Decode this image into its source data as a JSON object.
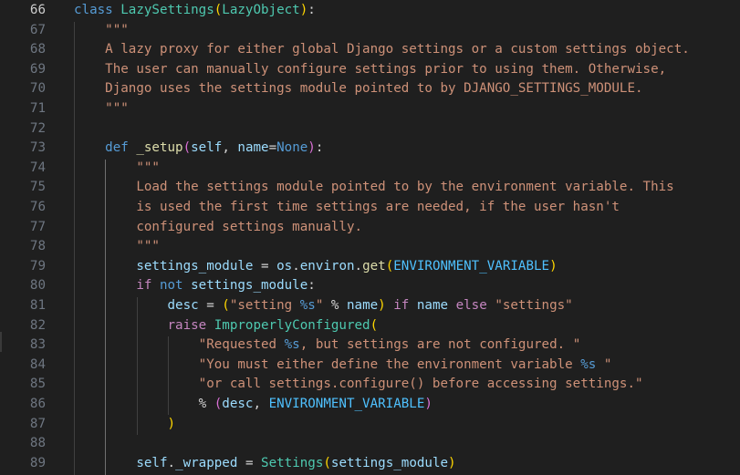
{
  "editor": {
    "active_line": "66",
    "lines": [
      {
        "num": "66",
        "tokens": [
          {
            "t": "kw",
            "v": "class "
          },
          {
            "t": "cls",
            "v": "LazySettings"
          },
          {
            "t": "p1",
            "v": "("
          },
          {
            "t": "cls",
            "v": "LazyObject"
          },
          {
            "t": "p1",
            "v": ")"
          },
          {
            "t": "plain",
            "v": ":"
          }
        ]
      },
      {
        "num": "67",
        "tokens": [
          {
            "t": "str",
            "v": "    \"\"\""
          }
        ]
      },
      {
        "num": "68",
        "tokens": [
          {
            "t": "str",
            "v": "    A lazy proxy for either global Django settings or a custom settings object."
          }
        ]
      },
      {
        "num": "69",
        "tokens": [
          {
            "t": "str",
            "v": "    The user can manually configure settings prior to using them. Otherwise,"
          }
        ]
      },
      {
        "num": "70",
        "tokens": [
          {
            "t": "str",
            "v": "    Django uses the settings module pointed to by DJANGO_SETTINGS_MODULE."
          }
        ]
      },
      {
        "num": "71",
        "tokens": [
          {
            "t": "str",
            "v": "    \"\"\""
          }
        ]
      },
      {
        "num": "72",
        "tokens": []
      },
      {
        "num": "73",
        "tokens": [
          {
            "t": "plain",
            "v": "    "
          },
          {
            "t": "kw",
            "v": "def "
          },
          {
            "t": "fn",
            "v": "_setup"
          },
          {
            "t": "p2",
            "v": "("
          },
          {
            "t": "var",
            "v": "self"
          },
          {
            "t": "plain",
            "v": ", "
          },
          {
            "t": "var",
            "v": "name"
          },
          {
            "t": "plain",
            "v": "="
          },
          {
            "t": "kw",
            "v": "None"
          },
          {
            "t": "p2",
            "v": ")"
          },
          {
            "t": "plain",
            "v": ":"
          }
        ]
      },
      {
        "num": "74",
        "tokens": [
          {
            "t": "str",
            "v": "        \"\"\""
          }
        ]
      },
      {
        "num": "75",
        "tokens": [
          {
            "t": "str",
            "v": "        Load the settings module pointed to by the environment variable. This"
          }
        ]
      },
      {
        "num": "76",
        "tokens": [
          {
            "t": "str",
            "v": "        is used the first time settings are needed, if the user hasn't"
          }
        ]
      },
      {
        "num": "77",
        "tokens": [
          {
            "t": "str",
            "v": "        configured settings manually."
          }
        ]
      },
      {
        "num": "78",
        "tokens": [
          {
            "t": "str",
            "v": "        \"\"\""
          }
        ]
      },
      {
        "num": "79",
        "tokens": [
          {
            "t": "plain",
            "v": "        "
          },
          {
            "t": "var",
            "v": "settings_module"
          },
          {
            "t": "plain",
            "v": " = "
          },
          {
            "t": "var",
            "v": "os"
          },
          {
            "t": "plain",
            "v": "."
          },
          {
            "t": "var",
            "v": "environ"
          },
          {
            "t": "plain",
            "v": "."
          },
          {
            "t": "fn",
            "v": "get"
          },
          {
            "t": "p1",
            "v": "("
          },
          {
            "t": "const",
            "v": "ENVIRONMENT_VARIABLE"
          },
          {
            "t": "p1",
            "v": ")"
          }
        ]
      },
      {
        "num": "80",
        "tokens": [
          {
            "t": "plain",
            "v": "        "
          },
          {
            "t": "ctl",
            "v": "if "
          },
          {
            "t": "kw",
            "v": "not "
          },
          {
            "t": "var",
            "v": "settings_module"
          },
          {
            "t": "plain",
            "v": ":"
          }
        ]
      },
      {
        "num": "81",
        "tokens": [
          {
            "t": "plain",
            "v": "            "
          },
          {
            "t": "var",
            "v": "desc"
          },
          {
            "t": "plain",
            "v": " = "
          },
          {
            "t": "p1",
            "v": "("
          },
          {
            "t": "str",
            "v": "\"setting "
          },
          {
            "t": "fmt",
            "v": "%s"
          },
          {
            "t": "str",
            "v": "\""
          },
          {
            "t": "plain",
            "v": " % "
          },
          {
            "t": "var",
            "v": "name"
          },
          {
            "t": "p1",
            "v": ")"
          },
          {
            "t": "plain",
            "v": " "
          },
          {
            "t": "ctl",
            "v": "if "
          },
          {
            "t": "var",
            "v": "name"
          },
          {
            "t": "plain",
            "v": " "
          },
          {
            "t": "ctl",
            "v": "else "
          },
          {
            "t": "str",
            "v": "\"settings\""
          }
        ]
      },
      {
        "num": "82",
        "tokens": [
          {
            "t": "plain",
            "v": "            "
          },
          {
            "t": "ctl",
            "v": "raise "
          },
          {
            "t": "cls",
            "v": "ImproperlyConfigured"
          },
          {
            "t": "p1",
            "v": "("
          }
        ]
      },
      {
        "num": "83",
        "tokens": [
          {
            "t": "plain",
            "v": "                "
          },
          {
            "t": "str",
            "v": "\"Requested "
          },
          {
            "t": "fmt",
            "v": "%s"
          },
          {
            "t": "str",
            "v": ", but settings are not configured. \""
          }
        ]
      },
      {
        "num": "84",
        "tokens": [
          {
            "t": "plain",
            "v": "                "
          },
          {
            "t": "str",
            "v": "\"You must either define the environment variable "
          },
          {
            "t": "fmt",
            "v": "%s"
          },
          {
            "t": "str",
            "v": " \""
          }
        ]
      },
      {
        "num": "85",
        "tokens": [
          {
            "t": "plain",
            "v": "                "
          },
          {
            "t": "str",
            "v": "\"or call settings.configure() before accessing settings.\""
          }
        ]
      },
      {
        "num": "86",
        "tokens": [
          {
            "t": "plain",
            "v": "                % "
          },
          {
            "t": "p2",
            "v": "("
          },
          {
            "t": "var",
            "v": "desc"
          },
          {
            "t": "plain",
            "v": ", "
          },
          {
            "t": "const",
            "v": "ENVIRONMENT_VARIABLE"
          },
          {
            "t": "p2",
            "v": ")"
          }
        ]
      },
      {
        "num": "87",
        "tokens": [
          {
            "t": "plain",
            "v": "            "
          },
          {
            "t": "p1",
            "v": ")"
          }
        ]
      },
      {
        "num": "88",
        "tokens": []
      },
      {
        "num": "89",
        "tokens": [
          {
            "t": "plain",
            "v": "        "
          },
          {
            "t": "var",
            "v": "self"
          },
          {
            "t": "plain",
            "v": "."
          },
          {
            "t": "var",
            "v": "_wrapped"
          },
          {
            "t": "plain",
            "v": " = "
          },
          {
            "t": "cls",
            "v": "Settings"
          },
          {
            "t": "p1",
            "v": "("
          },
          {
            "t": "var",
            "v": "settings_module"
          },
          {
            "t": "p1",
            "v": ")"
          }
        ]
      }
    ]
  },
  "colors": {
    "background": "#1f1f1f",
    "line_number": "#6e7681",
    "line_number_active": "#cccccc",
    "keyword": "#569cd6",
    "control_keyword": "#c586c0",
    "class_name": "#4ec9b0",
    "function_name": "#dcdcaa",
    "variable": "#9cdcfe",
    "string": "#ce9178",
    "constant": "#4fc1ff",
    "bracket_level_1": "#ffd700",
    "bracket_level_2": "#da70d6"
  }
}
